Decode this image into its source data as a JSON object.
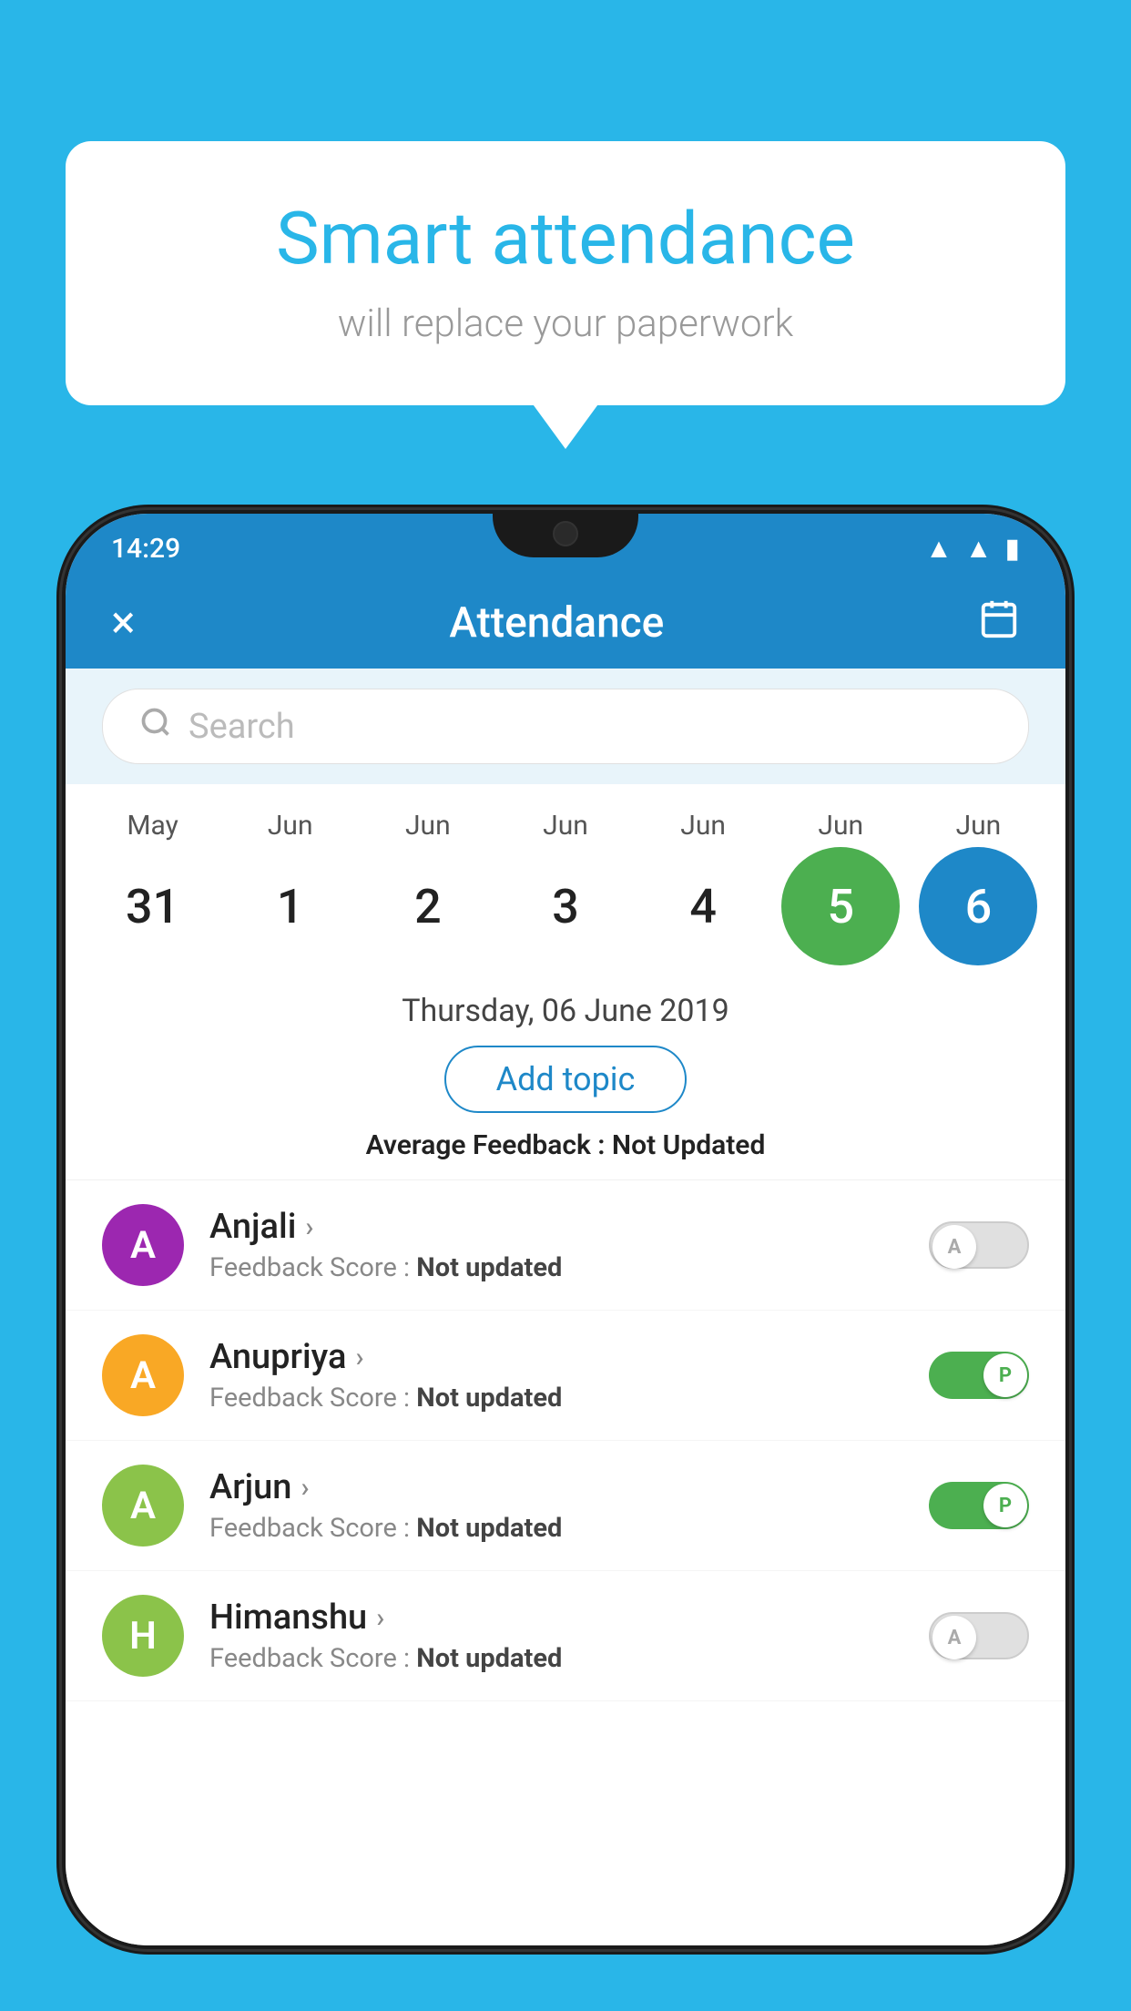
{
  "background_color": "#29b6e8",
  "speech_bubble": {
    "title": "Smart attendance",
    "subtitle": "will replace your paperwork"
  },
  "status_bar": {
    "time": "14:29",
    "icons": [
      "wifi",
      "signal",
      "battery"
    ]
  },
  "app_bar": {
    "title": "Attendance",
    "close_label": "×",
    "calendar_label": "📅"
  },
  "search": {
    "placeholder": "Search"
  },
  "calendar": {
    "months": [
      "May",
      "Jun",
      "Jun",
      "Jun",
      "Jun",
      "Jun",
      "Jun"
    ],
    "dates": [
      "31",
      "1",
      "2",
      "3",
      "4",
      "5",
      "6"
    ],
    "today_index": 5,
    "selected_index": 6
  },
  "selected_date": "Thursday, 06 June 2019",
  "add_topic_label": "Add topic",
  "average_feedback": {
    "label": "Average Feedback : ",
    "value": "Not Updated"
  },
  "students": [
    {
      "name": "Anjali",
      "feedback_label": "Feedback Score : ",
      "feedback_value": "Not updated",
      "avatar_letter": "A",
      "avatar_color": "#9c27b0",
      "toggle": "off",
      "toggle_letter": "A"
    },
    {
      "name": "Anupriya",
      "feedback_label": "Feedback Score : ",
      "feedback_value": "Not updated",
      "avatar_letter": "A",
      "avatar_color": "#f9a825",
      "toggle": "on",
      "toggle_letter": "P"
    },
    {
      "name": "Arjun",
      "feedback_label": "Feedback Score : ",
      "feedback_value": "Not updated",
      "avatar_letter": "A",
      "avatar_color": "#8bc34a",
      "toggle": "on",
      "toggle_letter": "P"
    },
    {
      "name": "Himanshu",
      "feedback_label": "Feedback Score : ",
      "feedback_value": "Not updated",
      "avatar_letter": "H",
      "avatar_color": "#8bc34a",
      "toggle": "off",
      "toggle_letter": "A"
    }
  ]
}
